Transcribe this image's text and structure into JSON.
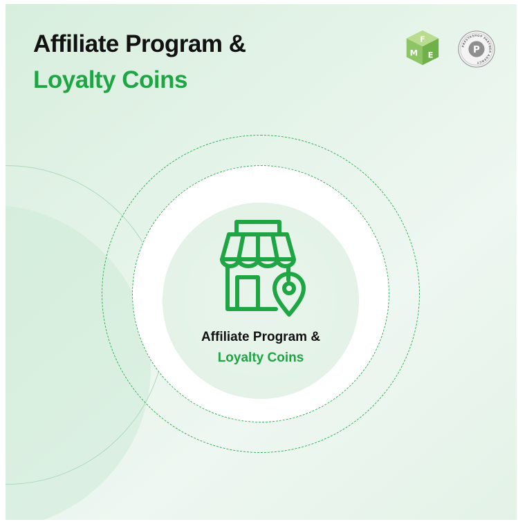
{
  "heading": {
    "line1": "Affiliate Program &",
    "line2": "Loyalty Coins"
  },
  "badge": {
    "line1": "Affiliate Program &",
    "line2": "Loyalty Coins"
  },
  "logos": {
    "fme_letters": [
      "F",
      "M",
      "E"
    ],
    "partner_letter": "P",
    "partner_text": "PRESTASHOP PARTNER AGENCY"
  },
  "icons": {
    "store": "store-with-location-pin-icon"
  },
  "colors": {
    "accent": "#1fa544",
    "text": "#111111",
    "background": "#e6f4ea",
    "dashed_ring": "#2fae55"
  }
}
